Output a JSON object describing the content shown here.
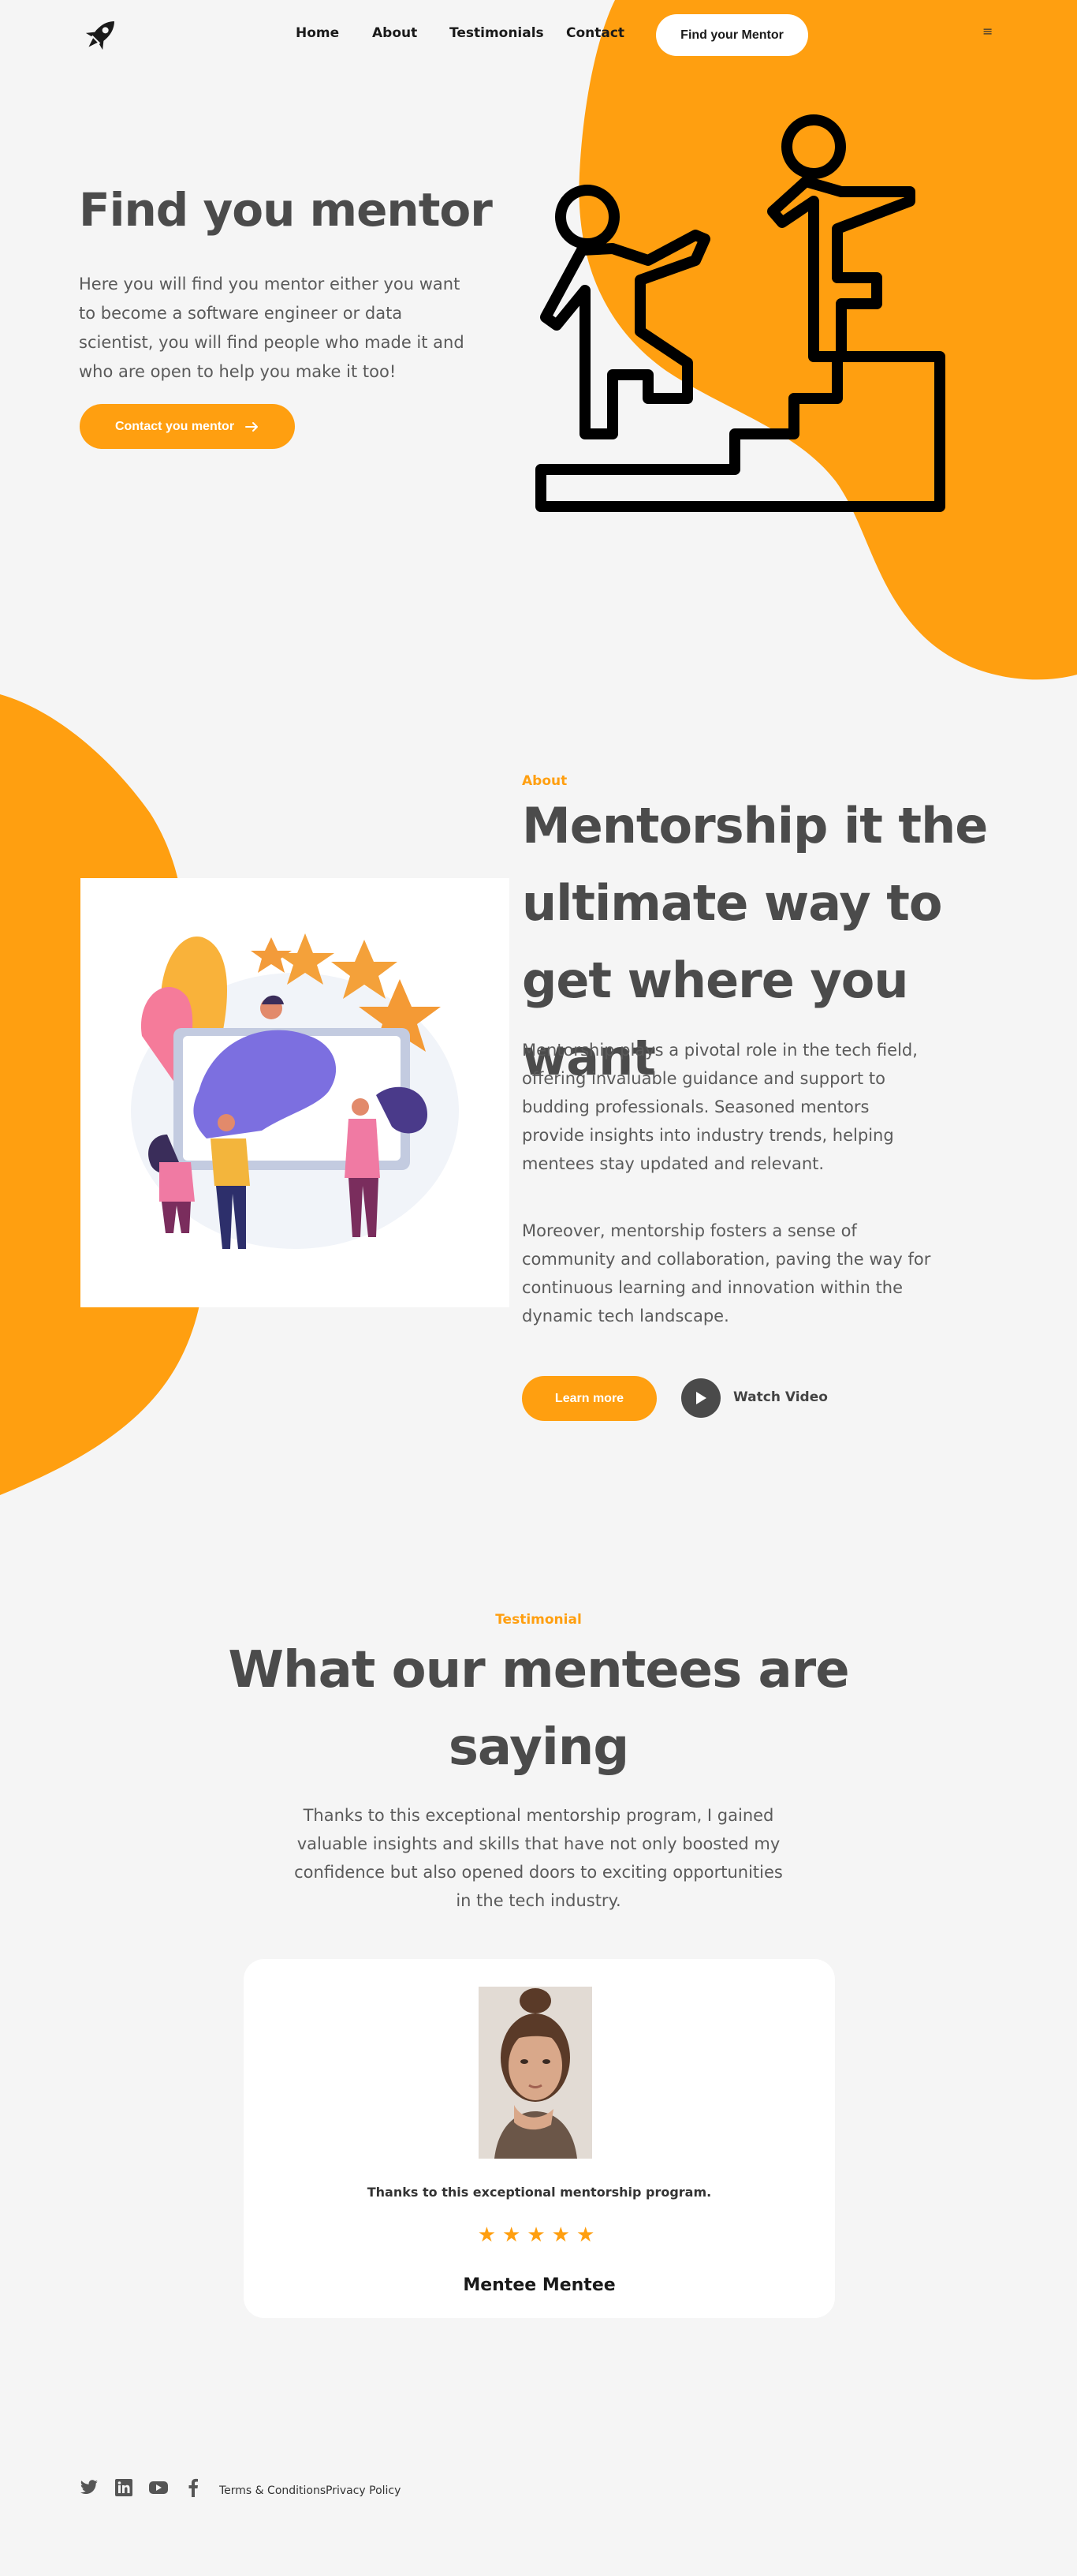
{
  "nav": {
    "logo_icon": "rocket-icon",
    "links": [
      "Home",
      "About",
      "Testimonials",
      "Contact"
    ],
    "cta": "Find your Mentor",
    "menu_icon": "≡"
  },
  "hero": {
    "title": "Find you mentor",
    "text": "Here you will find you mentor either you want to become a software engineer or data scientist, you will find people who made it and who are open to help you make it too!",
    "button": "Contact you mentor",
    "button_icon": "arrow-right-icon",
    "illustration": "mentor-helping-climb-stairs-icon"
  },
  "about": {
    "kicker": "About",
    "title": "Mentorship it the ultimate way to get where you want",
    "p1": "Mentorship plays a pivotal role in the tech field, offering invaluable guidance and support to budding professionals. Seasoned mentors provide insights into industry trends, helping mentees stay updated and relevant.",
    "p2": "Moreover, mentorship fosters a sense of community and collaboration, paving the way for continuous learning and innovation within the dynamic tech landscape.",
    "button": "Learn more",
    "watch": "Watch Video"
  },
  "testimonial": {
    "kicker": "Testimonial",
    "title": "What our mentees are saying",
    "text": "Thanks to this exceptional mentorship program, I gained valuable insights and skills that have not only boosted my confidence but also opened doors to exciting opportunities in the tech industry.",
    "card": {
      "quote": "Thanks to this exceptional mentorship program.",
      "stars": "★★★★★",
      "rating": 5,
      "name": "Mentee Mentee"
    }
  },
  "footer": {
    "social": [
      "twitter-icon",
      "linkedin-icon",
      "youtube-icon",
      "facebook-icon"
    ],
    "links": [
      "Terms & Conditions",
      "Privacy Policy"
    ]
  },
  "colors": {
    "accent": "#ff9f10",
    "background": "#f5f5f5",
    "heading": "#4b4b4b"
  }
}
